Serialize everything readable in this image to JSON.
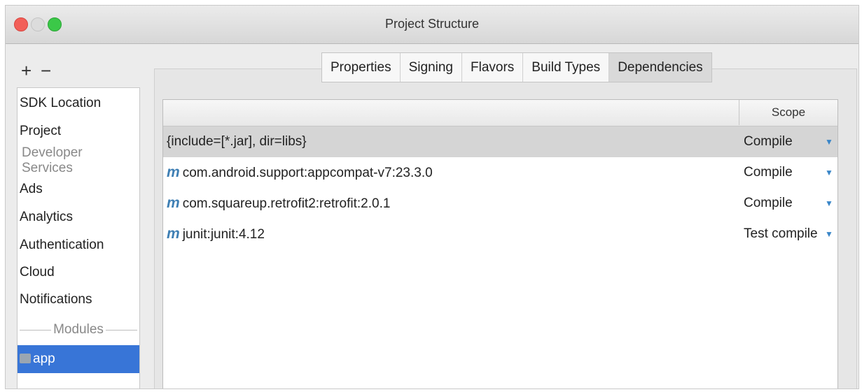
{
  "window": {
    "title": "Project Structure"
  },
  "toolbar": {
    "add_label": "+",
    "remove_label": "−"
  },
  "sidebar": {
    "items": [
      {
        "label": "SDK Location"
      },
      {
        "label": "Project"
      },
      {
        "label": "Ads"
      },
      {
        "label": "Analytics"
      },
      {
        "label": "Authentication"
      },
      {
        "label": "Cloud"
      },
      {
        "label": "Notifications"
      },
      {
        "label": "app",
        "selected": true
      }
    ],
    "sections": [
      "Developer Services",
      "Modules"
    ]
  },
  "tabs": [
    {
      "label": "Properties"
    },
    {
      "label": "Signing"
    },
    {
      "label": "Flavors"
    },
    {
      "label": "Build Types"
    },
    {
      "label": "Dependencies",
      "active": true
    }
  ],
  "table": {
    "columns": [
      "",
      "Scope"
    ],
    "rows": [
      {
        "icon": "",
        "dependency": "{include=[*.jar], dir=libs}",
        "scope": "Compile",
        "selected": true
      },
      {
        "icon": "m",
        "dependency": "com.android.support:appcompat-v7:23.3.0",
        "scope": "Compile"
      },
      {
        "icon": "m",
        "dependency": "com.squareup.retrofit2:retrofit:2.0.1",
        "scope": "Compile"
      },
      {
        "icon": "m",
        "dependency": "junit:junit:4.12",
        "scope": "Test compile"
      }
    ]
  },
  "colors": {
    "selection": "#3875d7",
    "maven_icon": "#3e7fb4",
    "dropdown_arrow": "#3a86c8"
  },
  "icons": {
    "dropdown": "triangle-down-icon",
    "maven": "maven-m-icon",
    "module": "folder-icon"
  }
}
